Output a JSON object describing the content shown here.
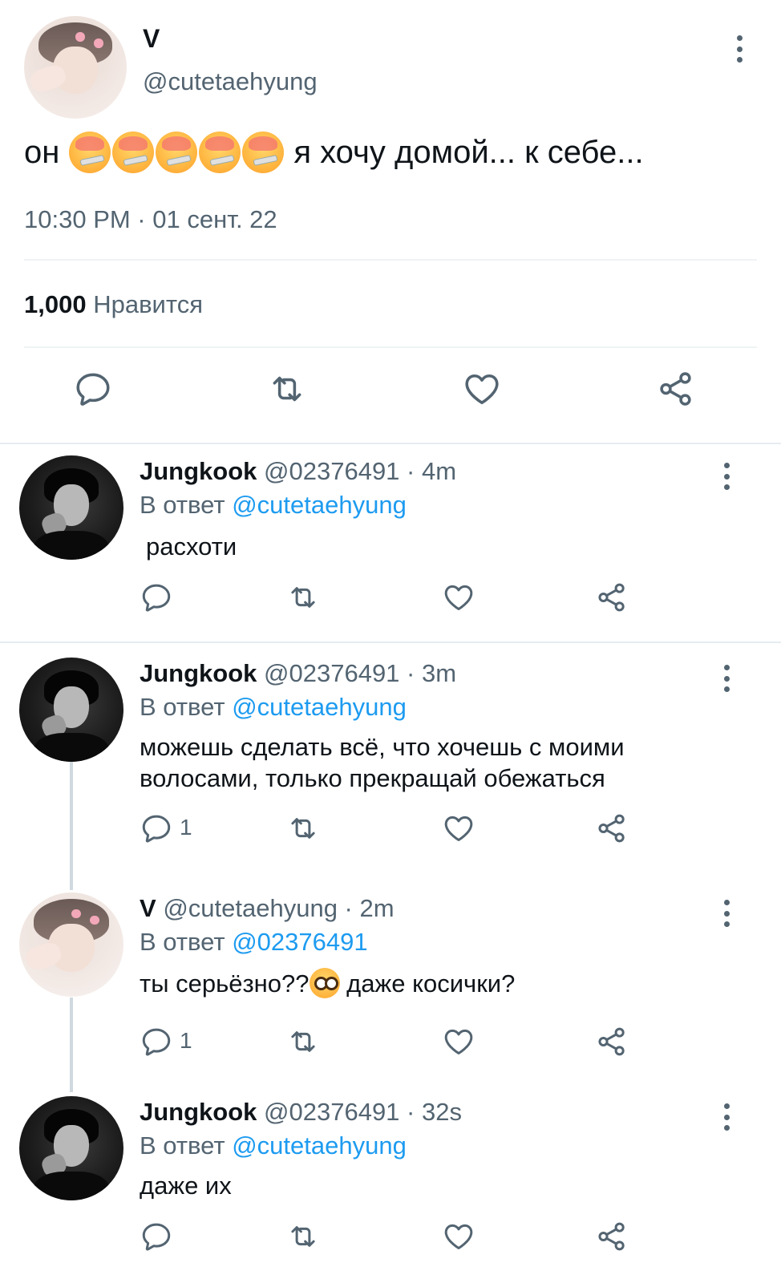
{
  "main_tweet": {
    "name": "V",
    "handle": "@cutetaehyung",
    "text_start": "он",
    "emoji_count": 5,
    "emoji_icon": "hot-face-thermometer-emoji",
    "text_end": "я хочу домой... к себе...",
    "timestamp": "10:30 PM · 01 сент. 22",
    "likes_count": "1,000",
    "likes_label": "Нравится"
  },
  "icons": {
    "reply": "speech-bubble-icon",
    "retweet": "retweet-icon",
    "like": "heart-icon",
    "share": "share-icon",
    "more": "vertical-dots-icon"
  },
  "colors": {
    "link": "#1d9bf0",
    "secondary_text": "#536471",
    "divider": "#eff3f4",
    "thread_line": "#cfd9de"
  },
  "replies": [
    {
      "name": "Jungkook",
      "handle_time": "@02376491 · 4m",
      "reply_prefix": "В ответ",
      "reply_to": "@cutetaehyung",
      "text": "расхоти",
      "reply_count": ""
    },
    {
      "name": "Jungkook",
      "handle_time": "@02376491 · 3m",
      "reply_prefix": "В ответ",
      "reply_to": "@cutetaehyung",
      "text_line1": "можешь сделать всё, что хочешь с моими",
      "text_line2": "волосами, только прекращай обежаться",
      "reply_count": "1"
    },
    {
      "name": "V",
      "handle_time": "@cutetaehyung · 2m",
      "reply_prefix": "В ответ",
      "reply_to": "@02376491",
      "text_start": "ты серьёзно??",
      "emoji_icon": "pleading-face-emoji",
      "text_end": "даже косички?",
      "reply_count": "1"
    },
    {
      "name": "Jungkook",
      "handle_time": "@02376491 · 32s",
      "reply_prefix": "В ответ",
      "reply_to": "@cutetaehyung",
      "text": "даже их",
      "reply_count": ""
    }
  ]
}
